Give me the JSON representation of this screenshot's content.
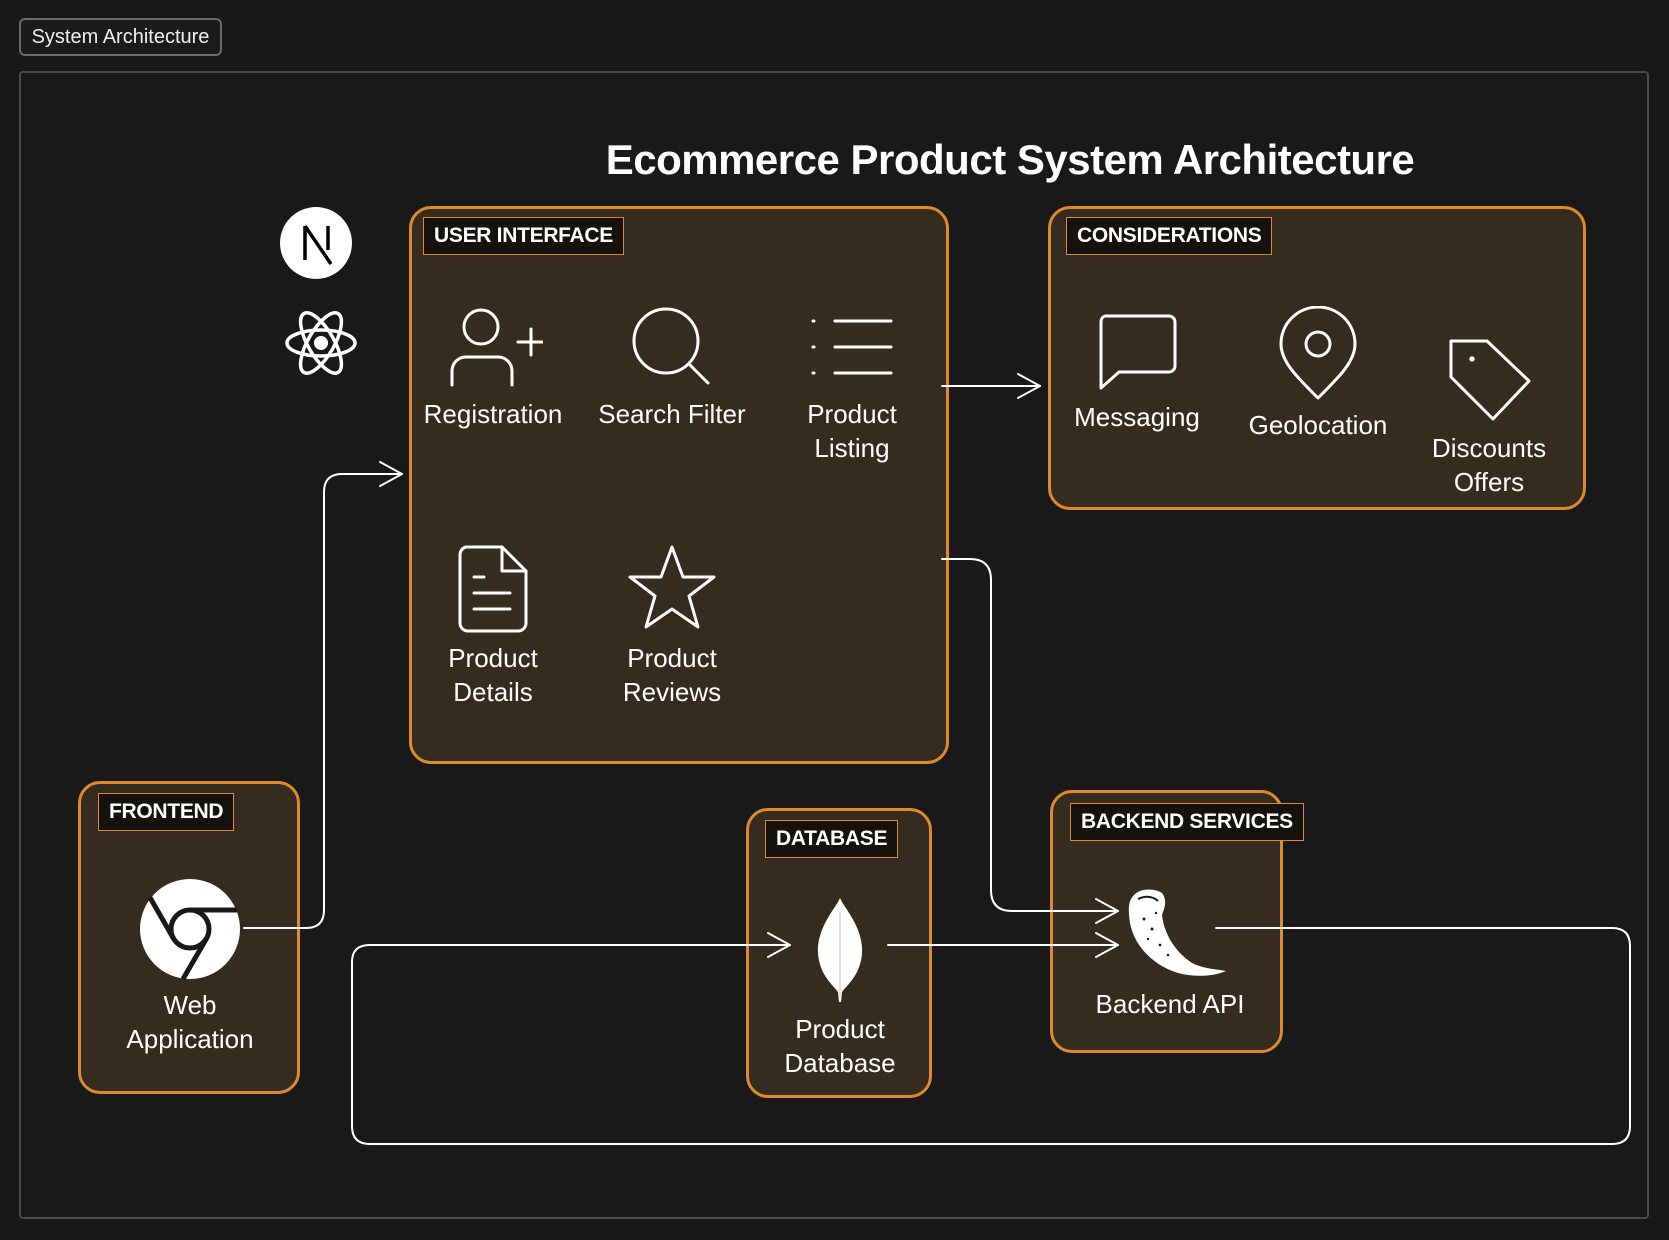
{
  "window": {
    "tab_title": "System Architecture"
  },
  "diagram": {
    "title": "Ecommerce Product System Architecture",
    "tech_badges": [
      "nextjs-logo",
      "react-logo"
    ],
    "groups": {
      "user_interface": {
        "label": "USER INTERFACE",
        "nodes": {
          "registration": {
            "label": "Registration",
            "icon": "user-plus-icon"
          },
          "search_filter": {
            "label": "Search Filter",
            "icon": "search-icon"
          },
          "product_listing": {
            "label_line1": "Product",
            "label_line2": "Listing",
            "icon": "list-icon"
          },
          "product_details": {
            "label_line1": "Product",
            "label_line2": "Details",
            "icon": "document-icon"
          },
          "product_reviews": {
            "label_line1": "Product",
            "label_line2": "Reviews",
            "icon": "star-icon"
          }
        }
      },
      "considerations": {
        "label": "CONSIDERATIONS",
        "nodes": {
          "messaging": {
            "label": "Messaging",
            "icon": "message-icon"
          },
          "geolocation": {
            "label": "Geolocation",
            "icon": "map-pin-icon"
          },
          "discounts_offers": {
            "label_line1": "Discounts",
            "label_line2": "Offers",
            "icon": "tag-icon"
          }
        }
      },
      "frontend": {
        "label": "FRONTEND",
        "nodes": {
          "web_application": {
            "label_line1": "Web",
            "label_line2": "Application",
            "icon": "chrome-icon"
          }
        }
      },
      "database": {
        "label": "DATABASE",
        "nodes": {
          "product_database": {
            "label_line1": "Product",
            "label_line2": "Database",
            "icon": "mongodb-icon"
          }
        }
      },
      "backend_services": {
        "label": "BACKEND SERVICES",
        "nodes": {
          "backend_api": {
            "label": "Backend API",
            "icon": "flask-icon"
          }
        }
      }
    },
    "edges": [
      {
        "from": "Web Application",
        "to": "USER INTERFACE"
      },
      {
        "from": "USER INTERFACE",
        "to": "CONSIDERATIONS"
      },
      {
        "from": "USER INTERFACE",
        "to": "Backend API"
      },
      {
        "from": "Product Database",
        "to": "Backend API"
      },
      {
        "from": "Backend API",
        "to": "Product Database"
      }
    ],
    "colors": {
      "background": "#181818",
      "group_border": "#dd8a2e",
      "group_fill": "#352b1f",
      "connector": "#ffffff"
    }
  }
}
